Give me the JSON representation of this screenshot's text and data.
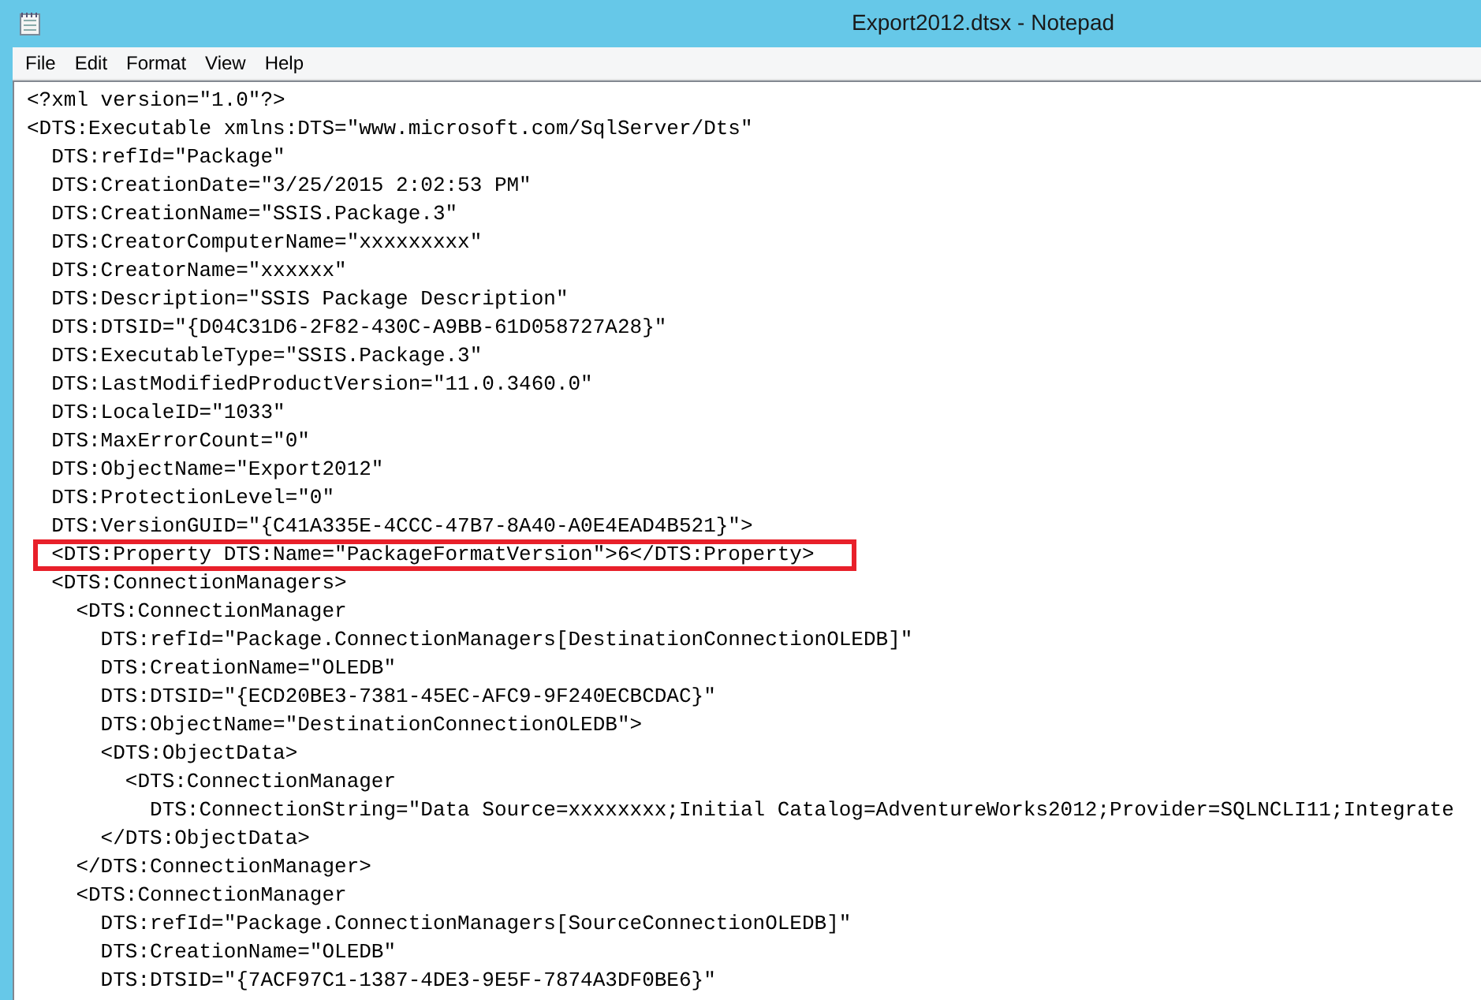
{
  "window": {
    "title": "Export2012.dtsx - Notepad"
  },
  "menu": [
    "File",
    "Edit",
    "Format",
    "View",
    "Help"
  ],
  "lines": [
    {
      "text": "<?xml version=\"1.0\"?>",
      "highlighted": false
    },
    {
      "text": "<DTS:Executable xmlns:DTS=\"www.microsoft.com/SqlServer/Dts\"",
      "highlighted": false
    },
    {
      "text": "  DTS:refId=\"Package\"",
      "highlighted": false
    },
    {
      "text": "  DTS:CreationDate=\"3/25/2015 2:02:53 PM\"",
      "highlighted": false
    },
    {
      "text": "  DTS:CreationName=\"SSIS.Package.3\"",
      "highlighted": false
    },
    {
      "text": "  DTS:CreatorComputerName=\"xxxxxxxxx\"",
      "highlighted": false
    },
    {
      "text": "  DTS:CreatorName=\"xxxxxx\"",
      "highlighted": false
    },
    {
      "text": "  DTS:Description=\"SSIS Package Description\"",
      "highlighted": false
    },
    {
      "text": "  DTS:DTSID=\"{D04C31D6-2F82-430C-A9BB-61D058727A28}\"",
      "highlighted": false
    },
    {
      "text": "  DTS:ExecutableType=\"SSIS.Package.3\"",
      "highlighted": false
    },
    {
      "text": "  DTS:LastModifiedProductVersion=\"11.0.3460.0\"",
      "highlighted": false
    },
    {
      "text": "  DTS:LocaleID=\"1033\"",
      "highlighted": false
    },
    {
      "text": "  DTS:MaxErrorCount=\"0\"",
      "highlighted": false
    },
    {
      "text": "  DTS:ObjectName=\"Export2012\"",
      "highlighted": false
    },
    {
      "text": "  DTS:ProtectionLevel=\"0\"",
      "highlighted": false
    },
    {
      "text": "  DTS:VersionGUID=\"{C41A335E-4CCC-47B7-8A40-A0E4EAD4B521}\">",
      "highlighted": false
    },
    {
      "text": "  <DTS:Property DTS:Name=\"PackageFormatVersion\">6</DTS:Property>",
      "highlighted": true
    },
    {
      "text": "  <DTS:ConnectionManagers>",
      "highlighted": false
    },
    {
      "text": "    <DTS:ConnectionManager",
      "highlighted": false
    },
    {
      "text": "      DTS:refId=\"Package.ConnectionManagers[DestinationConnectionOLEDB]\"",
      "highlighted": false
    },
    {
      "text": "      DTS:CreationName=\"OLEDB\"",
      "highlighted": false
    },
    {
      "text": "      DTS:DTSID=\"{ECD20BE3-7381-45EC-AFC9-9F240ECBCDAC}\"",
      "highlighted": false
    },
    {
      "text": "      DTS:ObjectName=\"DestinationConnectionOLEDB\">",
      "highlighted": false
    },
    {
      "text": "      <DTS:ObjectData>",
      "highlighted": false
    },
    {
      "text": "        <DTS:ConnectionManager",
      "highlighted": false
    },
    {
      "text": "          DTS:ConnectionString=\"Data Source=xxxxxxxx;Initial Catalog=AdventureWorks2012;Provider=SQLNCLI11;Integrate",
      "highlighted": false
    },
    {
      "text": "      </DTS:ObjectData>",
      "highlighted": false
    },
    {
      "text": "    </DTS:ConnectionManager>",
      "highlighted": false
    },
    {
      "text": "    <DTS:ConnectionManager",
      "highlighted": false
    },
    {
      "text": "      DTS:refId=\"Package.ConnectionManagers[SourceConnectionOLEDB]\"",
      "highlighted": false
    },
    {
      "text": "      DTS:CreationName=\"OLEDB\"",
      "highlighted": false
    },
    {
      "text": "      DTS:DTSID=\"{7ACF97C1-1387-4DE3-9E5F-7874A3DF0BE6}\"",
      "highlighted": false
    }
  ]
}
